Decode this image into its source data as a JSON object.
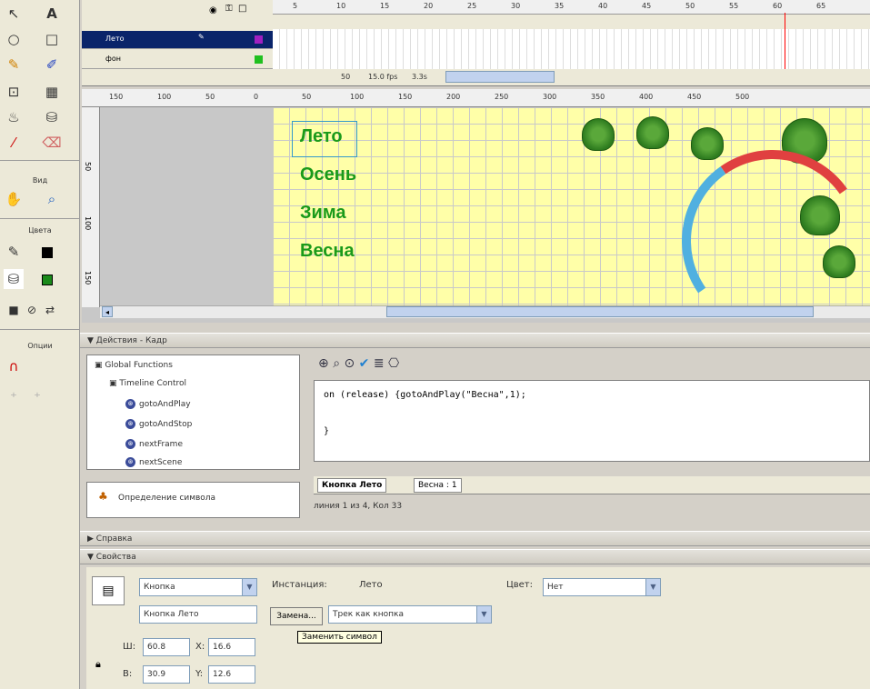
{
  "toolbox": {
    "view_label": "Вид",
    "colors_label": "Цвета",
    "options_label": "Опции",
    "text_tool": "A"
  },
  "timeline": {
    "layers": [
      {
        "name": "Лето"
      },
      {
        "name": "фон"
      }
    ],
    "ruler": [
      "5",
      "10",
      "15",
      "20",
      "25",
      "30",
      "35",
      "40",
      "45",
      "50",
      "55",
      "60",
      "65"
    ],
    "current_frame": "50",
    "fps": "15.0 fps",
    "elapsed": "3.3s"
  },
  "stage": {
    "hruler": [
      "150",
      "100",
      "50",
      "0",
      "50",
      "100",
      "150",
      "200",
      "250",
      "300",
      "350",
      "400",
      "450",
      "500"
    ],
    "vruler": [
      "50",
      "100",
      "150"
    ],
    "seasons": [
      "Лето",
      "Осень",
      "Зима",
      "Весна"
    ]
  },
  "actions_panel": {
    "title": "Действия - Кадр",
    "tree": {
      "root": "Global Functions",
      "group": "Timeline Control",
      "items": [
        "gotoAndPlay",
        "gotoAndStop",
        "nextFrame",
        "nextScene"
      ]
    },
    "symbol_def": "Определение символа",
    "code_lines": [
      "on (release) {gotoAndPlay(\"Весна\",1);",
      "",
      "}"
    ],
    "tabs": [
      "Кнопка Лето",
      "Весна : 1"
    ],
    "status": "линия 1 из 4, Кол 33"
  },
  "help_panel": {
    "title": "Справка"
  },
  "properties_panel": {
    "title": "Свойства",
    "symbol_type": "Кнопка",
    "instance_name": "Кнопка Лето",
    "instance_label": "Инстанция:",
    "instance_value": "Лето",
    "swap_button": "Замена...",
    "track_mode": "Трек как кнопка",
    "color_label": "Цвет:",
    "color_value": "Нет",
    "w_label": "Ш:",
    "w_value": "60.8",
    "h_label": "В:",
    "h_value": "30.9",
    "x_label": "X:",
    "x_value": "16.6",
    "y_label": "Y:",
    "y_value": "12.6",
    "tooltip": "Заменить символ"
  },
  "colors": {
    "accent": "#3b4c9a",
    "season_green": "#1a9a1a"
  }
}
